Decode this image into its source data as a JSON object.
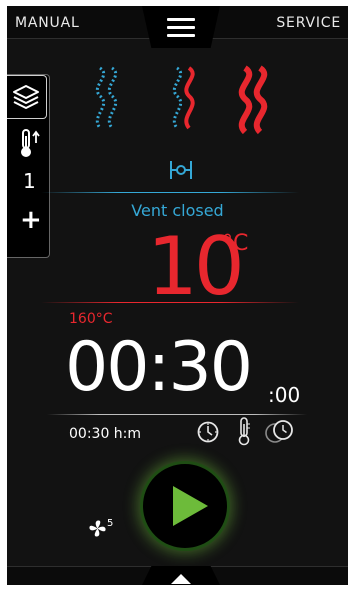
{
  "header": {
    "left_label": "MANUAL",
    "right_label": "SERVICE",
    "menu_icon": "hamburger-menu-icon"
  },
  "sidebar": {
    "layers_icon": "layers-icon",
    "probe_icon": "thermometer-up-icon",
    "value": "1",
    "add_label": "+"
  },
  "heat_levels": {
    "icons": [
      "wave-low-icon",
      "wave-medium-icon",
      "wave-high-icon"
    ],
    "colors": {
      "inactive": "#35a8d6",
      "active": "#e8272e"
    }
  },
  "vent": {
    "icon": "vent-valve-icon",
    "status": "Vent closed"
  },
  "temperature": {
    "value": "10",
    "unit": "°C",
    "setpoint": "160°C"
  },
  "timer": {
    "main": "00:30",
    "seconds": ":00",
    "mode_label": "00:30 h:m",
    "mode_icons": [
      "clock-icon",
      "core-probe-icon",
      "delta-clock-icon"
    ]
  },
  "controls": {
    "start_icon": "play-icon",
    "fan_icon": "fan-icon",
    "fan_speed": "5",
    "accent": "#6dbb3a"
  },
  "footer": {
    "expand_icon": "chevron-up-icon"
  }
}
